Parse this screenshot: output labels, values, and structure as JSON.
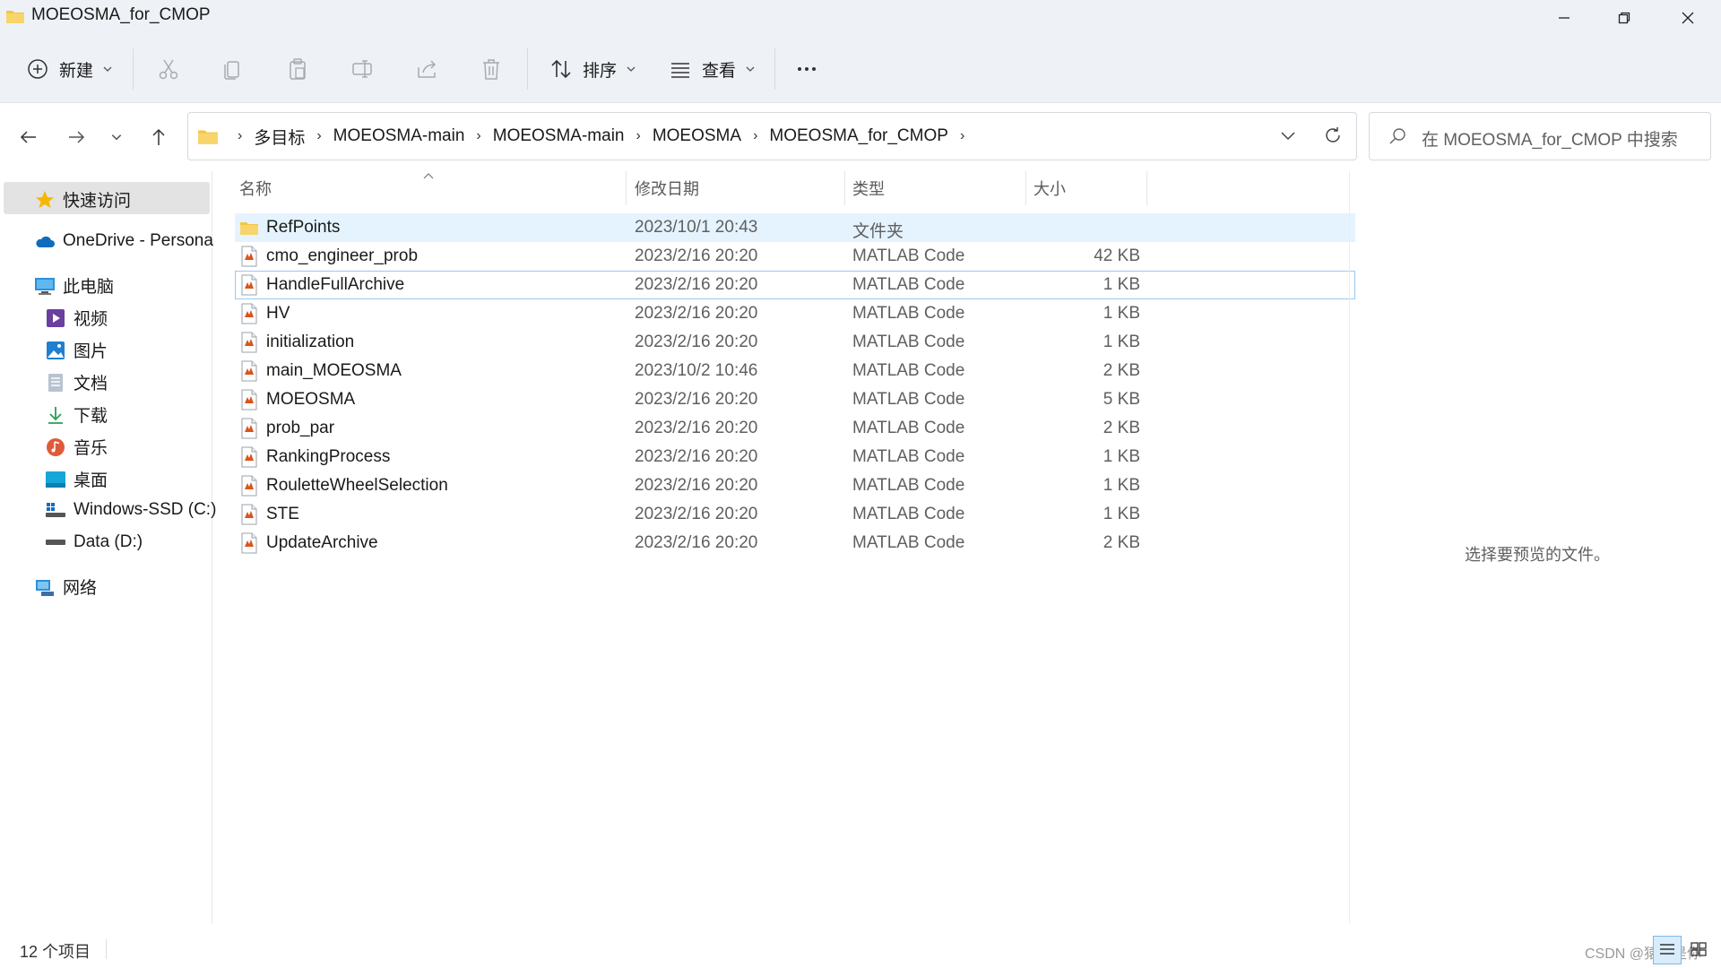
{
  "window": {
    "title": "MOEOSMA_for_CMOP"
  },
  "toolbar": {
    "new_label": "新建",
    "sort_label": "排序",
    "view_label": "查看",
    "icons": [
      "plus-circle-icon",
      "cut-icon",
      "copy-icon",
      "paste-icon",
      "rename-icon",
      "share-icon",
      "delete-icon",
      "sort-icon",
      "view-icon",
      "more-icon"
    ]
  },
  "address": {
    "crumbs": [
      "多目标",
      "MOEOSMA-main",
      "MOEOSMA-main",
      "MOEOSMA",
      "MOEOSMA_for_CMOP"
    ],
    "search_placeholder": "在 MOEOSMA_for_CMOP 中搜索"
  },
  "sidebar": {
    "quick_access": "快速访问",
    "onedrive": "OneDrive - Persona",
    "this_pc": "此电脑",
    "items": [
      {
        "label": "视频",
        "icon": "video-icon"
      },
      {
        "label": "图片",
        "icon": "pictures-icon"
      },
      {
        "label": "文档",
        "icon": "documents-icon"
      },
      {
        "label": "下载",
        "icon": "download-icon"
      },
      {
        "label": "音乐",
        "icon": "music-icon"
      },
      {
        "label": "桌面",
        "icon": "desktop-icon"
      },
      {
        "label": "Windows-SSD (C:)",
        "icon": "drive-c-icon"
      },
      {
        "label": "Data (D:)",
        "icon": "drive-d-icon"
      }
    ],
    "network": "网络"
  },
  "columns": {
    "name": "名称",
    "date": "修改日期",
    "type": "类型",
    "size": "大小"
  },
  "files": [
    {
      "name": "RefPoints",
      "date": "2023/10/1 20:43",
      "type": "文件夹",
      "size": "",
      "icon": "folder-icon"
    },
    {
      "name": "cmo_engineer_prob",
      "date": "2023/2/16 20:20",
      "type": "MATLAB Code",
      "size": "42 KB",
      "icon": "matlab-file-icon"
    },
    {
      "name": "HandleFullArchive",
      "date": "2023/2/16 20:20",
      "type": "MATLAB Code",
      "size": "1 KB",
      "icon": "matlab-file-icon"
    },
    {
      "name": "HV",
      "date": "2023/2/16 20:20",
      "type": "MATLAB Code",
      "size": "1 KB",
      "icon": "matlab-file-icon"
    },
    {
      "name": "initialization",
      "date": "2023/2/16 20:20",
      "type": "MATLAB Code",
      "size": "1 KB",
      "icon": "matlab-file-icon"
    },
    {
      "name": "main_MOEOSMA",
      "date": "2023/10/2 10:46",
      "type": "MATLAB Code",
      "size": "2 KB",
      "icon": "matlab-file-icon"
    },
    {
      "name": "MOEOSMA",
      "date": "2023/2/16 20:20",
      "type": "MATLAB Code",
      "size": "5 KB",
      "icon": "matlab-file-icon"
    },
    {
      "name": "prob_par",
      "date": "2023/2/16 20:20",
      "type": "MATLAB Code",
      "size": "2 KB",
      "icon": "matlab-file-icon"
    },
    {
      "name": "RankingProcess",
      "date": "2023/2/16 20:20",
      "type": "MATLAB Code",
      "size": "1 KB",
      "icon": "matlab-file-icon"
    },
    {
      "name": "RouletteWheelSelection",
      "date": "2023/2/16 20:20",
      "type": "MATLAB Code",
      "size": "1 KB",
      "icon": "matlab-file-icon"
    },
    {
      "name": "STE",
      "date": "2023/2/16 20:20",
      "type": "MATLAB Code",
      "size": "1 KB",
      "icon": "matlab-file-icon"
    },
    {
      "name": "UpdateArchive",
      "date": "2023/2/16 20:20",
      "type": "MATLAB Code",
      "size": "2 KB",
      "icon": "matlab-file-icon"
    }
  ],
  "preview": {
    "message": "选择要预览的文件。"
  },
  "status": {
    "count": "12 个项目",
    "watermark": "CSDN @猿来是你"
  },
  "colors": {
    "chrome_bg": "#eef2f7",
    "selection": "#e5f3ff",
    "focus_outline": "#99c9ef",
    "folder": "#f5c542",
    "accent": "#0078d4"
  }
}
